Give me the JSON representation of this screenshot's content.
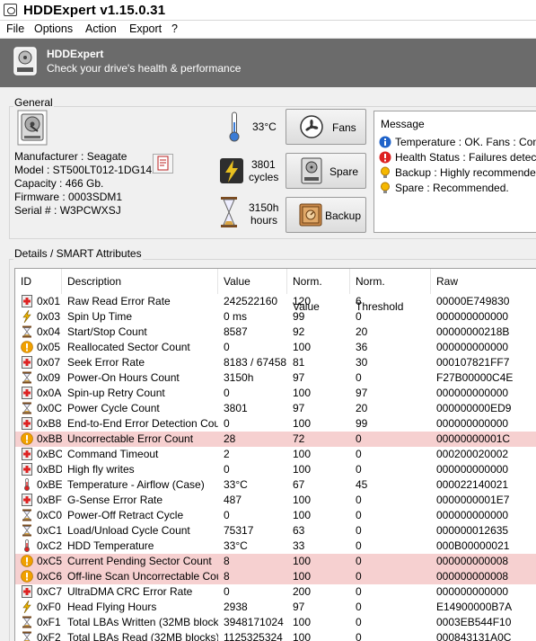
{
  "window": {
    "title": "HDDExpert v1.15.0.31"
  },
  "menu": [
    "File",
    "Options",
    "Action",
    "Export",
    "?"
  ],
  "banner": {
    "title": "HDDExpert",
    "subtitle": "Check your drive's health & performance"
  },
  "general": {
    "label": "General",
    "manufacturer": "Manufacturer : Seagate",
    "model": "Model : ST500LT012-1DG142",
    "capacity": "Capacity : 466 Gb.",
    "firmware": "Firmware : 0003SDM1",
    "serial": "Serial # : W3PCWXSJ",
    "temperature": "33°C",
    "cycles_line1": "3801",
    "cycles_line2": "cycles",
    "hours_line1": "3150h",
    "hours_line2": "hours",
    "buttons": {
      "fans": "Fans",
      "spare": "Spare",
      "backup": "Backup"
    }
  },
  "message": {
    "title": "Message",
    "items": [
      {
        "icon": "info-icon",
        "text": "Temperature : OK. Fans : Conside"
      },
      {
        "icon": "error-icon",
        "text": "Health Status : Failures detected."
      },
      {
        "icon": "bulb-icon",
        "text": "Backup : Highly recommended."
      },
      {
        "icon": "bulb-icon",
        "text": "Spare : Recommended."
      }
    ]
  },
  "details": {
    "label": "Details / SMART Attributes",
    "columns": [
      "ID",
      "Description",
      "Value",
      "Norm. Value",
      "Norm. Threshold",
      "Raw"
    ],
    "rows": [
      {
        "icon": "hdd-plus-icon",
        "id": "0x01",
        "desc": "Raw Read Error Rate",
        "value": "242522160",
        "norm": "120",
        "thr": "6",
        "raw": "00000E749830",
        "warn": false
      },
      {
        "icon": "lightning-icon",
        "id": "0x03",
        "desc": "Spin Up Time",
        "value": "0 ms",
        "norm": "99",
        "thr": "0",
        "raw": "000000000000",
        "warn": false
      },
      {
        "icon": "hourglass-icon",
        "id": "0x04",
        "desc": "Start/Stop Count",
        "value": "8587",
        "norm": "92",
        "thr": "20",
        "raw": "00000000218B",
        "warn": false
      },
      {
        "icon": "warning-icon",
        "id": "0x05",
        "desc": "Reallocated Sector Count",
        "value": "0",
        "norm": "100",
        "thr": "36",
        "raw": "000000000000",
        "warn": false
      },
      {
        "icon": "hdd-plus-icon",
        "id": "0x07",
        "desc": "Seek Error Rate",
        "value": "8183 / 67458",
        "norm": "81",
        "thr": "30",
        "raw": "000107821FF7",
        "warn": false
      },
      {
        "icon": "hourglass-icon",
        "id": "0x09",
        "desc": "Power-On Hours Count",
        "value": "3150h",
        "norm": "97",
        "thr": "0",
        "raw": "F27B00000C4E",
        "warn": false
      },
      {
        "icon": "hdd-plus-icon",
        "id": "0x0A",
        "desc": "Spin-up Retry Count",
        "value": "0",
        "norm": "100",
        "thr": "97",
        "raw": "000000000000",
        "warn": false
      },
      {
        "icon": "hourglass-icon",
        "id": "0x0C",
        "desc": "Power Cycle Count",
        "value": "3801",
        "norm": "97",
        "thr": "20",
        "raw": "000000000ED9",
        "warn": false
      },
      {
        "icon": "hdd-plus-icon",
        "id": "0xB8",
        "desc": "End-to-End Error Detection Count",
        "value": "0",
        "norm": "100",
        "thr": "99",
        "raw": "000000000000",
        "warn": false
      },
      {
        "icon": "warning-icon",
        "id": "0xBB",
        "desc": "Uncorrectable Error Count",
        "value": "28",
        "norm": "72",
        "thr": "0",
        "raw": "00000000001C",
        "warn": true
      },
      {
        "icon": "hdd-plus-icon",
        "id": "0xBC",
        "desc": "Command Timeout",
        "value": "2",
        "norm": "100",
        "thr": "0",
        "raw": "000200020002",
        "warn": false
      },
      {
        "icon": "hdd-plus-icon",
        "id": "0xBD",
        "desc": "High fly writes",
        "value": "0",
        "norm": "100",
        "thr": "0",
        "raw": "000000000000",
        "warn": false
      },
      {
        "icon": "thermometer-icon",
        "id": "0xBE",
        "desc": "Temperature - Airflow (Case)",
        "value": "33°C",
        "norm": "67",
        "thr": "45",
        "raw": "000022140021",
        "warn": false
      },
      {
        "icon": "hdd-plus-icon",
        "id": "0xBF",
        "desc": "G-Sense Error Rate",
        "value": "487",
        "norm": "100",
        "thr": "0",
        "raw": "0000000001E7",
        "warn": false
      },
      {
        "icon": "hourglass-icon",
        "id": "0xC0",
        "desc": "Power-Off Retract Cycle",
        "value": "0",
        "norm": "100",
        "thr": "0",
        "raw": "000000000000",
        "warn": false
      },
      {
        "icon": "hourglass-icon",
        "id": "0xC1",
        "desc": "Load/Unload Cycle Count",
        "value": "75317",
        "norm": "63",
        "thr": "0",
        "raw": "000000012635",
        "warn": false
      },
      {
        "icon": "thermometer-icon",
        "id": "0xC2",
        "desc": "HDD Temperature",
        "value": "33°C",
        "norm": "33",
        "thr": "0",
        "raw": "000B00000021",
        "warn": false
      },
      {
        "icon": "warning-icon",
        "id": "0xC5",
        "desc": "Current Pending Sector Count",
        "value": "8",
        "norm": "100",
        "thr": "0",
        "raw": "000000000008",
        "warn": true
      },
      {
        "icon": "warning-icon",
        "id": "0xC6",
        "desc": "Off-line Scan Uncorrectable Count",
        "value": "8",
        "norm": "100",
        "thr": "0",
        "raw": "000000000008",
        "warn": true
      },
      {
        "icon": "hdd-plus-icon",
        "id": "0xC7",
        "desc": "UltraDMA CRC Error Rate",
        "value": "0",
        "norm": "200",
        "thr": "0",
        "raw": "000000000000",
        "warn": false
      },
      {
        "icon": "lightning-icon",
        "id": "0xF0",
        "desc": "Head Flying Hours",
        "value": "2938",
        "norm": "97",
        "thr": "0",
        "raw": "E14900000B7A",
        "warn": false
      },
      {
        "icon": "hourglass-icon",
        "id": "0xF1",
        "desc": "Total LBAs Written (32MB blocks)",
        "value": "3948171024",
        "norm": "100",
        "thr": "0",
        "raw": "0003EB544F10",
        "warn": false
      },
      {
        "icon": "hourglass-icon",
        "id": "0xF2",
        "desc": "Total LBAs Read (32MB blocks)",
        "value": "1125325324",
        "norm": "100",
        "thr": "0",
        "raw": "000843131A0C",
        "warn": false
      }
    ]
  }
}
